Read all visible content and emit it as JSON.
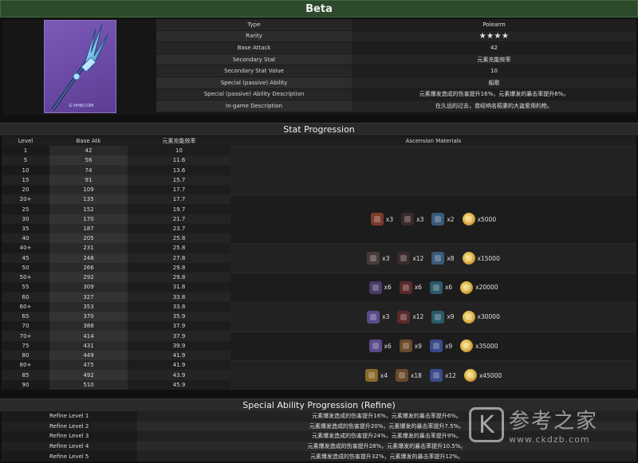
{
  "title": "Beta",
  "info": [
    {
      "key": "Type",
      "value": "Polearm"
    },
    {
      "key": "Rarity",
      "value": "★★★★"
    },
    {
      "key": "Base Attack",
      "value": "42"
    },
    {
      "key": "Secondary Stat",
      "value": "元素充能效率"
    },
    {
      "key": "Secondary Stat Value",
      "value": "10"
    },
    {
      "key": "Special (passive) Ability",
      "value": "船歌"
    },
    {
      "key": "Special (passive) Ability Description",
      "value": "元素爆发造成的伤害提升16%，元素爆发的暴击率提升6%。"
    },
    {
      "key": "In-game Description",
      "value": "在久远的过去，曾经响名稻妻的大盗爱用的枪。"
    }
  ],
  "weapon_image_label": "G-HHW.COM",
  "stat_section_title": "Stat Progression",
  "stat_headers": {
    "level": "Level",
    "atk": "Base Atk",
    "secondary": "元素充能效率",
    "materials": "Ascension Materials"
  },
  "stats": [
    {
      "level": "1",
      "atk": "42",
      "sec": "10"
    },
    {
      "level": "5",
      "atk": "56",
      "sec": "11.6"
    },
    {
      "level": "10",
      "atk": "74",
      "sec": "13.6"
    },
    {
      "level": "15",
      "atk": "91",
      "sec": "15.7"
    },
    {
      "level": "20",
      "atk": "109",
      "sec": "17.7"
    },
    {
      "level": "20+",
      "atk": "135",
      "sec": "17.7"
    },
    {
      "level": "25",
      "atk": "152",
      "sec": "19.7"
    },
    {
      "level": "30",
      "atk": "170",
      "sec": "21.7"
    },
    {
      "level": "35",
      "atk": "187",
      "sec": "23.7"
    },
    {
      "level": "40",
      "atk": "205",
      "sec": "25.8"
    },
    {
      "level": "40+",
      "atk": "231",
      "sec": "25.8"
    },
    {
      "level": "45",
      "atk": "248",
      "sec": "27.8"
    },
    {
      "level": "50",
      "atk": "266",
      "sec": "29.8"
    },
    {
      "level": "50+",
      "atk": "292",
      "sec": "29.8"
    },
    {
      "level": "55",
      "atk": "309",
      "sec": "31.8"
    },
    {
      "level": "60",
      "atk": "327",
      "sec": "33.8"
    },
    {
      "level": "60+",
      "atk": "353",
      "sec": "33.8"
    },
    {
      "level": "65",
      "atk": "370",
      "sec": "35.9"
    },
    {
      "level": "70",
      "atk": "388",
      "sec": "37.9"
    },
    {
      "level": "70+",
      "atk": "414",
      "sec": "37.9"
    },
    {
      "level": "75",
      "atk": "431",
      "sec": "39.9"
    },
    {
      "level": "80",
      "atk": "449",
      "sec": "41.9"
    },
    {
      "level": "80+",
      "atk": "475",
      "sec": "41.9"
    },
    {
      "level": "85",
      "atk": "492",
      "sec": "43.9"
    },
    {
      "level": "90",
      "atk": "510",
      "sec": "45.9"
    }
  ],
  "ascensions": [
    {
      "start": 5,
      "rows": 5,
      "mats": [
        {
          "icon": "red-ore-icon",
          "color": "#7a3a2a",
          "qty": "x3"
        },
        {
          "icon": "dark-shard-icon",
          "color": "#3a2a2a",
          "qty": "x3"
        },
        {
          "icon": "blue-crystal-icon",
          "color": "#3a5a7a",
          "qty": "x2"
        },
        {
          "icon": "mora-coin-icon",
          "coin": true,
          "qty": "x5000"
        }
      ]
    },
    {
      "start": 10,
      "rows": 3,
      "mats": [
        {
          "icon": "dark-ore-icon",
          "color": "#4a3a3a",
          "qty": "x3"
        },
        {
          "icon": "dark-shard-icon",
          "color": "#3a2a2a",
          "qty": "x12"
        },
        {
          "icon": "blue-crystal-icon",
          "color": "#3a5a7a",
          "qty": "x8"
        },
        {
          "icon": "mora-coin-icon",
          "coin": true,
          "qty": "x15000"
        }
      ]
    },
    {
      "start": 13,
      "rows": 3,
      "mats": [
        {
          "icon": "purple-ore-icon",
          "color": "#4a3a6a",
          "qty": "x6"
        },
        {
          "icon": "crimson-shard-icon",
          "color": "#5a2a2a",
          "qty": "x6"
        },
        {
          "icon": "teal-crystal-icon",
          "color": "#2a5a6a",
          "qty": "x6"
        },
        {
          "icon": "mora-coin-icon",
          "coin": true,
          "qty": "x20000"
        }
      ]
    },
    {
      "start": 16,
      "rows": 3,
      "mats": [
        {
          "icon": "violet-ore-icon",
          "color": "#5a4a8a",
          "qty": "x3"
        },
        {
          "icon": "crimson-shard-icon",
          "color": "#5a2a2a",
          "qty": "x12"
        },
        {
          "icon": "teal-crystal-icon",
          "color": "#2a5a6a",
          "qty": "x9"
        },
        {
          "icon": "mora-coin-icon",
          "coin": true,
          "qty": "x30000"
        }
      ]
    },
    {
      "start": 19,
      "rows": 3,
      "mats": [
        {
          "icon": "violet-ore-icon",
          "color": "#5a4a8a",
          "qty": "x6"
        },
        {
          "icon": "gold-shard-icon",
          "color": "#6a4a2a",
          "qty": "x9"
        },
        {
          "icon": "blue-gem-icon",
          "color": "#3a4a8a",
          "qty": "x9"
        },
        {
          "icon": "mora-coin-icon",
          "coin": true,
          "qty": "x35000"
        }
      ]
    },
    {
      "start": 22,
      "rows": 3,
      "mats": [
        {
          "icon": "gold-ore-icon",
          "color": "#8a6a2a",
          "qty": "x4"
        },
        {
          "icon": "gold-shard-icon",
          "color": "#6a4a2a",
          "qty": "x18"
        },
        {
          "icon": "blue-gem-icon",
          "color": "#3a4a8a",
          "qty": "x12"
        },
        {
          "icon": "mora-coin-icon",
          "coin": true,
          "qty": "x45000"
        }
      ]
    }
  ],
  "refine_section_title": "Special Ability Progression (Refine)",
  "refines": [
    {
      "label": "Refine Level 1",
      "value": "元素爆发造成的伤害提升16%，元素爆发的暴击率提升6%。"
    },
    {
      "label": "Refine Level 2",
      "value": "元素爆发造成的伤害提升20%，元素爆发的暴击率提升7.5%。"
    },
    {
      "label": "Refine Level 3",
      "value": "元素爆发造成的伤害提升24%，元素爆发的暴击率提升9%。"
    },
    {
      "label": "Refine Level 4",
      "value": "元素爆发造成的伤害提升28%，元素爆发的暴击率提升10.5%。"
    },
    {
      "label": "Refine Level 5",
      "value": "元素爆发造成的伤害提升32%，元素爆发的暴击率提升12%。"
    }
  ],
  "watermark": {
    "letter": "K",
    "cn": "参考之家",
    "url": "www.ckdzb.com"
  }
}
